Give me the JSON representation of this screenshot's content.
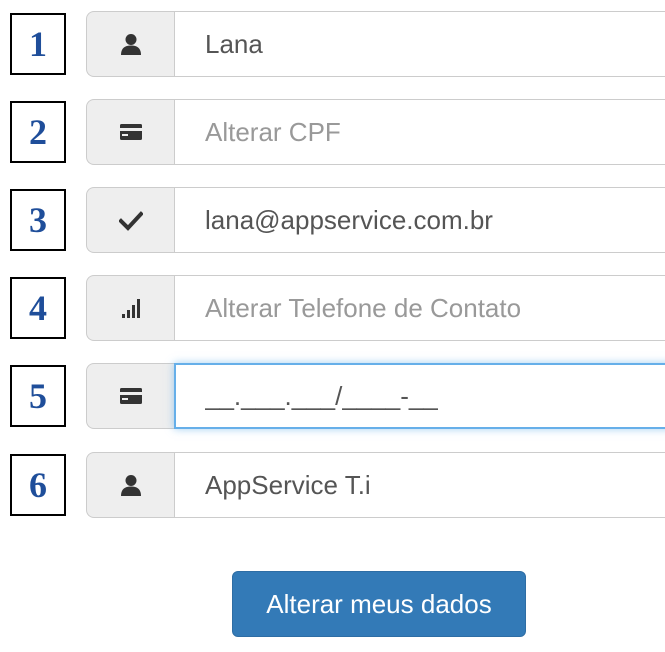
{
  "rows": [
    {
      "number": "1",
      "icon": "user-icon",
      "value": "Lana",
      "placeholder": ""
    },
    {
      "number": "2",
      "icon": "credit-card-icon",
      "value": "",
      "placeholder": "Alterar CPF"
    },
    {
      "number": "3",
      "icon": "checkmark-icon",
      "value": "lana@appservice.com.br",
      "placeholder": ""
    },
    {
      "number": "4",
      "icon": "signal-bars-icon",
      "value": "",
      "placeholder": "Alterar Telefone de Contato"
    },
    {
      "number": "5",
      "icon": "credit-card-icon",
      "value": "__.___.___/____-__",
      "placeholder": ""
    },
    {
      "number": "6",
      "icon": "user-icon",
      "value": "AppService T.i",
      "placeholder": ""
    }
  ],
  "submit_label": "Alterar meus dados",
  "colors": {
    "number_label": "#1f4e9a",
    "button": "#337ab7",
    "focus_border": "#66afe9",
    "addon_bg": "#eeeeee",
    "icon": "#333333"
  }
}
